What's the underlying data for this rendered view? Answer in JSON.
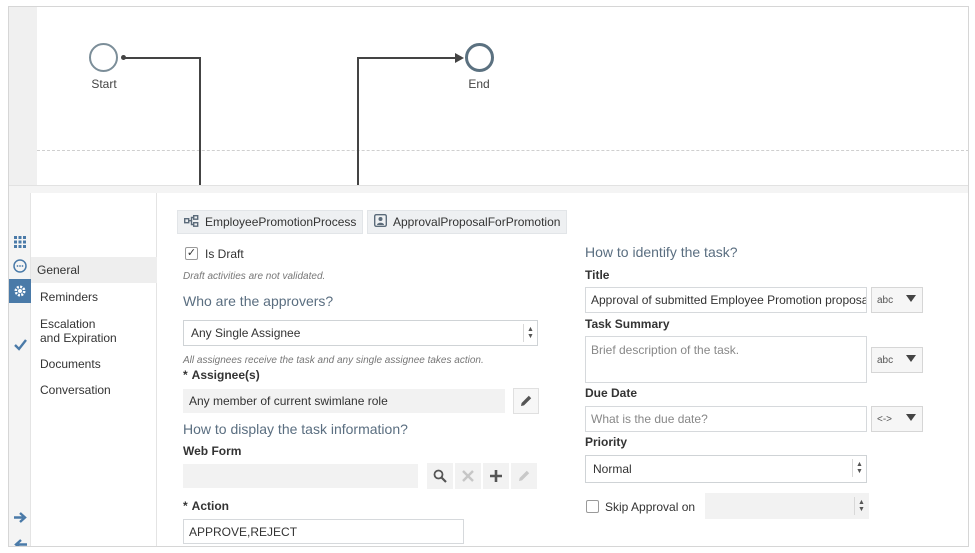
{
  "canvas": {
    "start_label": "Start",
    "end_label": "End"
  },
  "rail": {
    "icons": [
      "grid-icon",
      "comment-icon",
      "gear-icon",
      "check-icon",
      "arrow-right-icon",
      "arrow-left-icon"
    ]
  },
  "nav": {
    "items": [
      {
        "label": "General",
        "active": true
      },
      {
        "label": "Reminders"
      },
      {
        "label_line1": "Escalation",
        "label_line2": "and Expiration"
      },
      {
        "label": "Documents"
      },
      {
        "label": "Conversation"
      }
    ]
  },
  "crumbs": {
    "process": "EmployeePromotionProcess",
    "activity": "ApprovalProposalForPromotion"
  },
  "left": {
    "is_draft_label": "Is Draft",
    "is_draft_checked": true,
    "draft_hint": "Draft activities are not validated.",
    "approvers_title": "Who are the approvers?",
    "assignee_type_value": "Any Single Assignee",
    "assignee_hint": "All assignees receive the task and any single assignee takes action.",
    "assignees_label": "Assignee(s)",
    "assignees_value": "Any member of current swimlane role",
    "display_title": "How to display the task information?",
    "web_form_label": "Web Form",
    "web_form_value": "",
    "action_label": "Action",
    "action_value": "APPROVE,REJECT",
    "required_mark": "*"
  },
  "right": {
    "identify_title": "How to identify the task?",
    "title_label": "Title",
    "title_value": "Approval of submitted Employee Promotion proposals",
    "title_type": "abc",
    "summary_label": "Task Summary",
    "summary_placeholder": "Brief description of the task.",
    "summary_type": "abc",
    "due_label": "Due Date",
    "due_placeholder": "What is the due date?",
    "due_type": "<->",
    "priority_label": "Priority",
    "priority_value": "Normal",
    "skip_label": "Skip Approval on",
    "skip_checked": false,
    "skip_value": ""
  },
  "colors": {
    "accent": "#4a7aa8",
    "section_title": "#5a6e80"
  }
}
